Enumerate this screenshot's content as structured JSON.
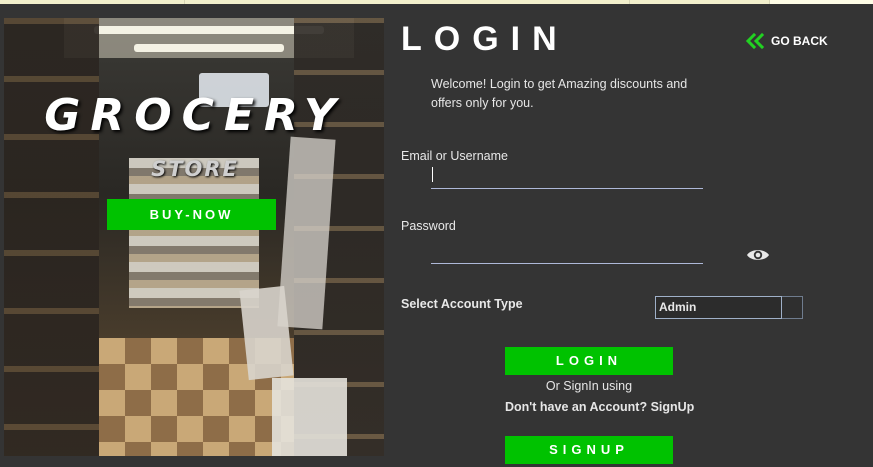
{
  "promo": {
    "brand": "GROCERY",
    "subtitle": "STORE",
    "buy_button": "BUY-NOW"
  },
  "login": {
    "title": "LOGIN",
    "go_back": "GO BACK",
    "welcome": "Welcome! Login to get Amazing discounts and offers only for you.",
    "email_label": "Email or Username",
    "email_value": "",
    "password_label": "Password",
    "password_value": "",
    "account_type_label": "Select Account Type",
    "account_type_value": "Admin",
    "login_button": "LOGIN",
    "or_signin": "Or SignIn using",
    "no_account": "Don't have an Account? SignUp",
    "signup_button": "SIGNUP"
  },
  "icons": {
    "go_back": "double-chevron-left-icon",
    "password_toggle": "eye-icon",
    "dropdown": "dropdown-arrow-icon"
  },
  "colors": {
    "background": "#343434",
    "accent_green": "#00c200",
    "field_underline": "#aeb8d8"
  }
}
